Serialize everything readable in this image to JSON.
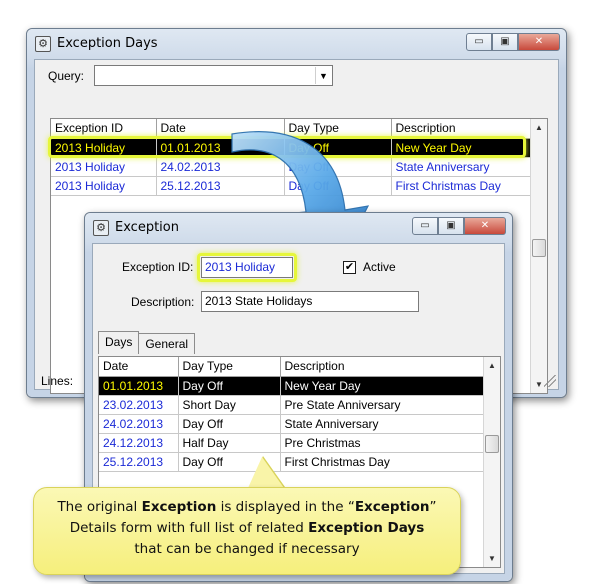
{
  "outer_window": {
    "title": "Exception Days",
    "query_label": "Query:",
    "query_value": "",
    "columns": [
      "Exception ID",
      "Date",
      "Day Type",
      "Description"
    ],
    "rows": [
      {
        "id": "2013 Holiday",
        "date": "01.01.2013",
        "type": "Day Off",
        "desc": "New Year Day"
      },
      {
        "id": "2013 Holiday",
        "date": "24.02.2013",
        "type": "Day Off",
        "desc": "State Anniversary"
      },
      {
        "id": "2013 Holiday",
        "date": "25.12.2013",
        "type": "Day Off",
        "desc": "First Christmas Day"
      }
    ],
    "status_label": "Lines:"
  },
  "inner_window": {
    "title": "Exception",
    "exception_id_label": "Exception ID:",
    "exception_id_value": "2013 Holiday",
    "active_label": "Active",
    "active_checked": "✔",
    "description_label": "Description:",
    "description_value": "2013 State Holidays",
    "tabs": [
      "Days",
      "General"
    ],
    "columns": [
      "Date",
      "Day Type",
      "Description"
    ],
    "rows": [
      {
        "date": "01.01.2013",
        "type": "Day Off",
        "desc": "New Year Day"
      },
      {
        "date": "23.02.2013",
        "type": "Short Day",
        "desc": "Pre State Anniversary"
      },
      {
        "date": "24.02.2013",
        "type": "Day Off",
        "desc": "State Anniversary"
      },
      {
        "date": "24.12.2013",
        "type": "Half Day",
        "desc": "Pre Christmas"
      },
      {
        "date": "25.12.2013",
        "type": "Day Off",
        "desc": "First Christmas Day"
      }
    ]
  },
  "window_controls": {
    "minimize": "▭",
    "maximize": "▣",
    "close": "✕"
  },
  "scroll_arrows": {
    "up": "▲",
    "down": "▼",
    "dropdown": "▼"
  },
  "callout": {
    "p1": "The original ",
    "b1": "Exception",
    "p2": " is displayed in the “",
    "b2": "Exception",
    "p3": "”",
    "p4": "Details form with full list of related ",
    "b3": "Exception Days",
    "p5": "that can be changed if necessary"
  },
  "colors": {
    "accent_blue": "#1b2ad6",
    "highlight_yellow": "#e6f63a",
    "arrow_blue": "#3a8fd8"
  }
}
